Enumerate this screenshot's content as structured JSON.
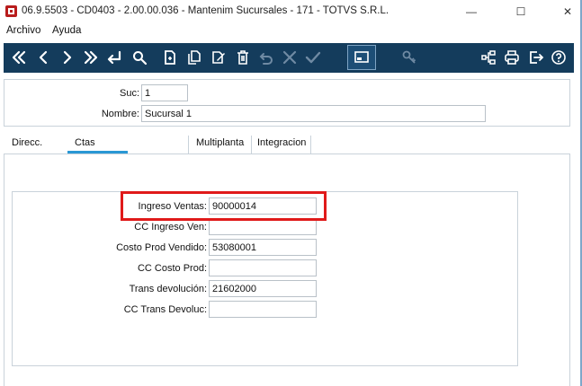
{
  "window": {
    "title": "06.9.5503 - CD0403 - 2.00.00.036 - Mantenim Sucursales - 171 - TOTVS S.R.L.",
    "minimize_glyph": "—",
    "maximize_glyph": "☐",
    "close_glyph": "✕"
  },
  "menu": {
    "items": [
      "Archivo",
      "Ayuda"
    ]
  },
  "toolbar": {
    "buttons": [
      "first-record-icon",
      "previous-record-icon",
      "next-record-icon",
      "last-record-icon",
      "return-icon",
      "search-icon",
      "new-record-icon",
      "copy-record-icon",
      "edit-record-icon",
      "delete-icon",
      "undo-icon",
      "cancel-icon",
      "confirm-icon",
      "screen-icon",
      "key-icon",
      "structure-icon",
      "print-icon",
      "exit-icon",
      "help-icon"
    ],
    "colors": {
      "background": "#143c5c",
      "icon": "#ffffff",
      "disabled_icon": "#6f8aa3"
    }
  },
  "header_fields": {
    "suc_label": "Suc:",
    "suc_value": "1",
    "nombre_label": "Nombre:",
    "nombre_value": "Sucursal 1"
  },
  "tabs": {
    "left": [
      "Direcc.",
      "Ctas"
    ],
    "right": [
      "Multiplanta",
      "Integracion"
    ],
    "active": "Ctas"
  },
  "accounts": {
    "ingreso_ventas_label": "Ingreso Ventas:",
    "ingreso_ventas_value": "90000014",
    "cc_ingreso_ven_label": "CC Ingreso Ven:",
    "cc_ingreso_ven_value": "",
    "costo_prod_vendido_label": "Costo Prod Vendido:",
    "costo_prod_vendido_value": "53080001",
    "cc_costo_prod_label": "CC Costo Prod:",
    "cc_costo_prod_value": "",
    "trans_devolucion_label": "Trans devolución:",
    "trans_devolucion_value": "21602000",
    "cc_trans_devoluc_label": "CC Trans Devoluc:",
    "cc_trans_devoluc_value": ""
  },
  "colors": {
    "highlight": "#e01a1a",
    "tab_active": "#2a98d4",
    "border": "#c9d2da"
  }
}
